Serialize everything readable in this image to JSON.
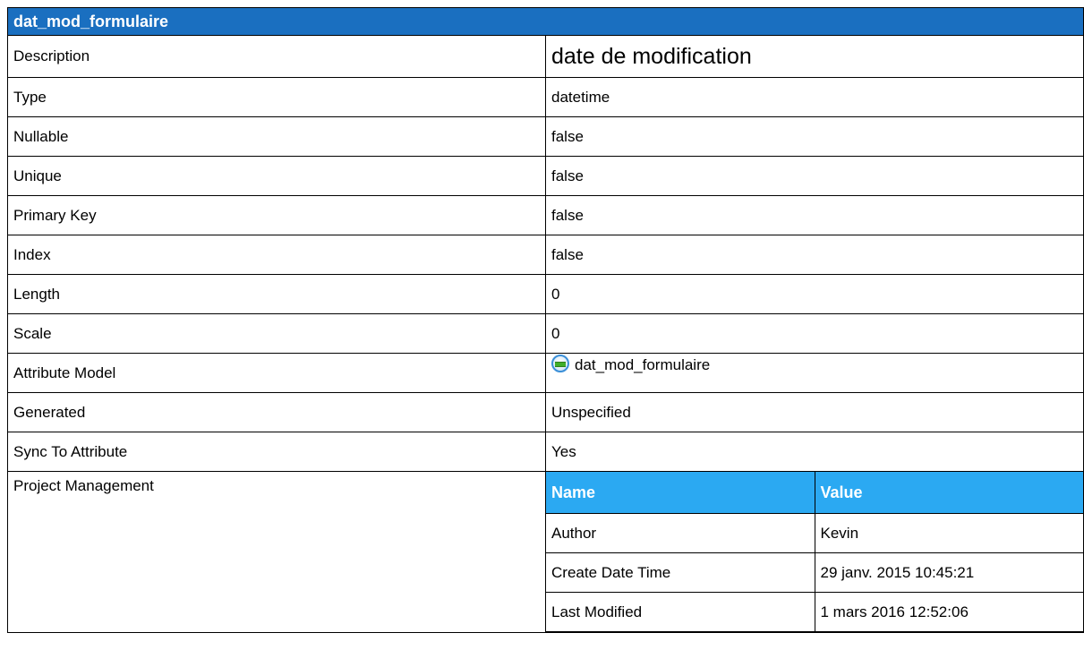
{
  "header": {
    "title": "dat_mod_formulaire"
  },
  "rows": {
    "description": {
      "label": "Description",
      "value": "date de modification"
    },
    "type": {
      "label": "Type",
      "value": "datetime"
    },
    "nullable": {
      "label": "Nullable",
      "value": "false"
    },
    "unique": {
      "label": "Unique",
      "value": "false"
    },
    "primary_key": {
      "label": "Primary Key",
      "value": "false"
    },
    "index": {
      "label": "Index",
      "value": "false"
    },
    "length": {
      "label": "Length",
      "value": "0"
    },
    "scale": {
      "label": "Scale",
      "value": "0"
    },
    "attribute_model": {
      "label": "Attribute Model",
      "value": "dat_mod_formulaire",
      "icon": "attribute-model-icon"
    },
    "generated": {
      "label": "Generated",
      "value": "Unspecified"
    },
    "sync_to_attribute": {
      "label": "Sync To Attribute",
      "value": "Yes"
    },
    "project_management": {
      "label": "Project Management"
    }
  },
  "project_management": {
    "columns": [
      "Name",
      "Value"
    ],
    "rows": [
      [
        "Author",
        "Kevin"
      ],
      [
        "Create Date Time",
        "29 janv. 2015 10:45:21"
      ],
      [
        "Last Modified",
        "1 mars 2016 12:52:06"
      ]
    ]
  },
  "colors": {
    "header_bg": "#1a6fc0",
    "subheader_bg": "#2ba9f2",
    "border": "#000000",
    "icon_green": "#3fae2a"
  }
}
